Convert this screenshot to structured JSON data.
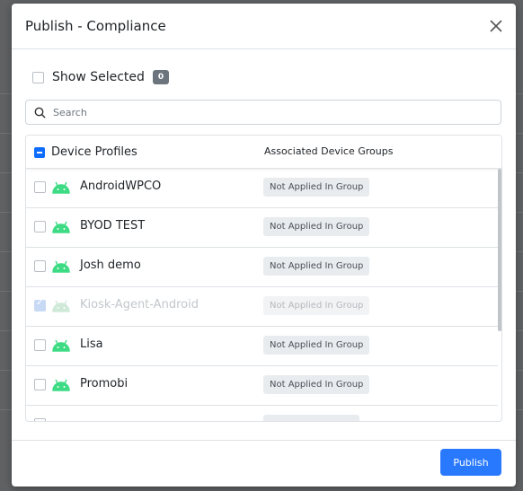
{
  "modal": {
    "title": "Publish - Compliance",
    "close_icon": "close-icon"
  },
  "show_selected": {
    "label": "Show Selected",
    "count": "0"
  },
  "search": {
    "placeholder": "Search",
    "value": ""
  },
  "table": {
    "columns": [
      "Device Profiles",
      "Associated Device Groups"
    ],
    "rows": [
      {
        "name": "AndroidWPCO",
        "status": "Not Applied In Group",
        "icon": "android-icon"
      },
      {
        "name": "BYOD TEST",
        "status": "Not Applied In Group",
        "icon": "android-icon"
      },
      {
        "name": "Josh demo",
        "status": "Not Applied In Group",
        "icon": "android-icon"
      },
      {
        "name": "Kiosk-Agent-Android",
        "status": "Not Applied In Group",
        "icon": "android-icon",
        "disabled": true,
        "checked": true
      },
      {
        "name": "Lisa",
        "status": "Not Applied In Group",
        "icon": "android-icon"
      },
      {
        "name": "Promobi",
        "status": "Not Applied In Group",
        "icon": "android-icon"
      }
    ]
  },
  "footer": {
    "publish_label": "Publish"
  },
  "colors": {
    "accent": "#2979ff",
    "android_green": "#3ddc84",
    "badge": "#6c757d"
  }
}
